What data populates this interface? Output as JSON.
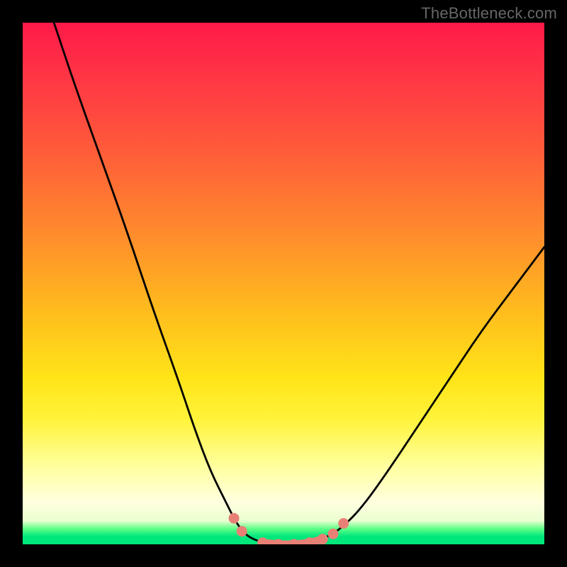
{
  "watermark": "TheBottleneck.com",
  "chart_data": {
    "type": "line",
    "title": "",
    "xlabel": "",
    "ylabel": "",
    "xlim": [
      0,
      100
    ],
    "ylim": [
      0,
      100
    ],
    "series": [
      {
        "name": "bottleneck-curve",
        "x": [
          6,
          10,
          15,
          20,
          25,
          30,
          33,
          36,
          39,
          41,
          43,
          46,
          49,
          52,
          55,
          58,
          61,
          65,
          70,
          76,
          82,
          88,
          94,
          100
        ],
        "values": [
          100,
          88,
          74,
          60,
          45,
          31,
          22,
          14,
          8,
          4,
          1.5,
          0.3,
          0,
          0,
          0.3,
          1.2,
          3,
          7,
          14,
          23,
          32,
          41,
          49,
          57
        ]
      }
    ],
    "highlight_points": {
      "name": "valley-markers",
      "color": "#e98076",
      "x": [
        40.5,
        42,
        46,
        49,
        52,
        55,
        57.5,
        59.5,
        61.5
      ],
      "values": [
        5,
        2.5,
        0.3,
        0,
        0,
        0.3,
        1.0,
        2.0,
        4.0
      ]
    },
    "gradient_bands": [
      {
        "color": "#ff1a49",
        "stop": 0
      },
      {
        "color": "#ffbb1e",
        "stop": 55
      },
      {
        "color": "#ffff9e",
        "stop": 85
      },
      {
        "color": "#00e77c",
        "stop": 100
      }
    ]
  }
}
